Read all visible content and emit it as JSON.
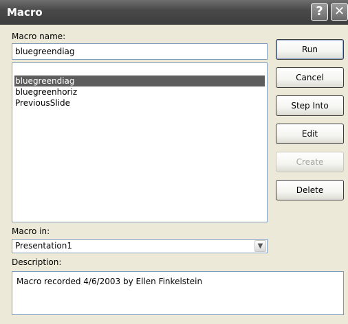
{
  "window": {
    "title": "Macro",
    "help_glyph": "?",
    "close_glyph": "✕"
  },
  "macro_name": {
    "label": "Macro name:",
    "value": "bluegreendiag"
  },
  "macro_list": {
    "items": [
      "bluegreendiag",
      "bluegreenhoriz",
      "PreviousSlide"
    ],
    "selected_index": 0
  },
  "buttons": {
    "run": "Run",
    "cancel": "Cancel",
    "step_into": "Step Into",
    "edit": "Edit",
    "create": "Create",
    "delete": "Delete"
  },
  "macro_in": {
    "label": "Macro in:",
    "value": "Presentation1",
    "arrow_glyph": "▼"
  },
  "description": {
    "label": "Description:",
    "value": "Macro recorded 4/6/2003 by Ellen Finkelstein"
  }
}
